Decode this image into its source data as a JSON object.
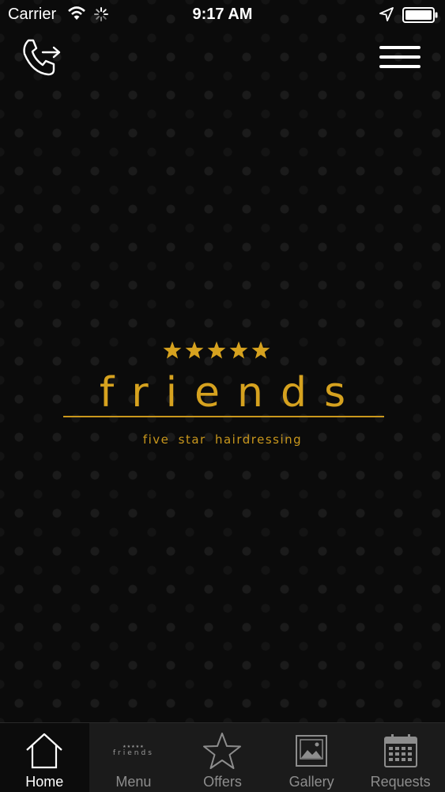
{
  "status_bar": {
    "carrier": "Carrier",
    "time": "9:17 AM",
    "icons": [
      "wifi-icon",
      "spinner-icon",
      "location-icon",
      "battery-icon"
    ]
  },
  "header": {
    "call_icon": "phone-forward-icon",
    "menu_icon": "hamburger-icon"
  },
  "logo": {
    "stars": 5,
    "name": "friends",
    "tagline": "five star hairdressing",
    "color": "#d6a21f"
  },
  "tabs": [
    {
      "label": "Home",
      "icon": "home-icon",
      "active": true
    },
    {
      "label": "Menu",
      "icon": "friends-logo-icon",
      "logo_text": "friends",
      "active": false
    },
    {
      "label": "Offers",
      "icon": "star-icon",
      "active": false
    },
    {
      "label": "Gallery",
      "icon": "gallery-icon",
      "active": false
    },
    {
      "label": "Requests",
      "icon": "calendar-icon",
      "active": false
    }
  ],
  "colors": {
    "background": "#0b0b0b",
    "accent": "#d6a21f",
    "tab_bar": "#1b1b1b",
    "tab_inactive": "#8d8d8d",
    "tab_active": "#ffffff"
  }
}
